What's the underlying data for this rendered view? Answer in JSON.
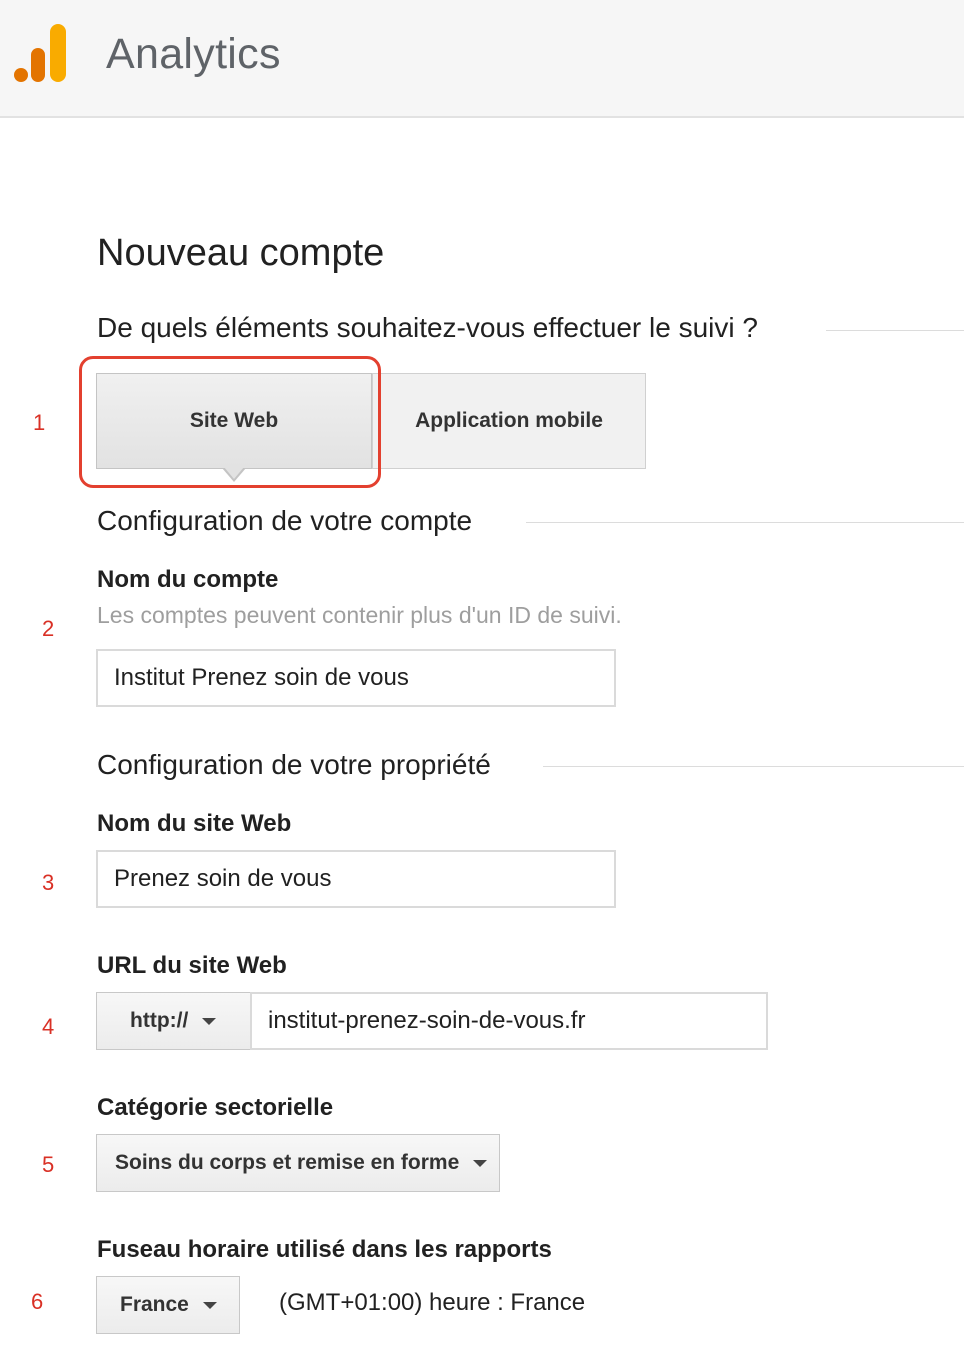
{
  "header": {
    "app_title": "Analytics",
    "logo_icon": "analytics-logo-icon"
  },
  "page": {
    "title": "Nouveau compte"
  },
  "tracking": {
    "question": "De quels éléments souhaitez-vous effectuer le suivi ?",
    "options": [
      {
        "label": "Site Web",
        "selected": true
      },
      {
        "label": "Application mobile",
        "selected": false
      }
    ]
  },
  "account": {
    "heading": "Configuration de votre compte",
    "name_label": "Nom du compte",
    "name_help": "Les comptes peuvent contenir plus d'un ID de suivi.",
    "name_value": "Institut Prenez soin de vous"
  },
  "property": {
    "heading": "Configuration de votre propriété",
    "site_name_label": "Nom du site Web",
    "site_name_value": "Prenez soin de vous",
    "url_label": "URL du site Web",
    "protocol_value": "http://",
    "url_value": "institut-prenez-soin-de-vous.fr",
    "category_label": "Catégorie sectorielle",
    "category_value": "Soins du corps et remise en forme",
    "timezone_label": "Fuseau horaire utilisé dans les rapports",
    "timezone_country": "France",
    "timezone_text": "(GMT+01:00) heure : France"
  },
  "steps": [
    "1",
    "2",
    "3",
    "4",
    "5",
    "6"
  ],
  "colors": {
    "step_number": "#d93025",
    "highlight_border": "#e3402f",
    "logo_orange": "#e37400",
    "logo_yellow": "#f9ab00"
  }
}
